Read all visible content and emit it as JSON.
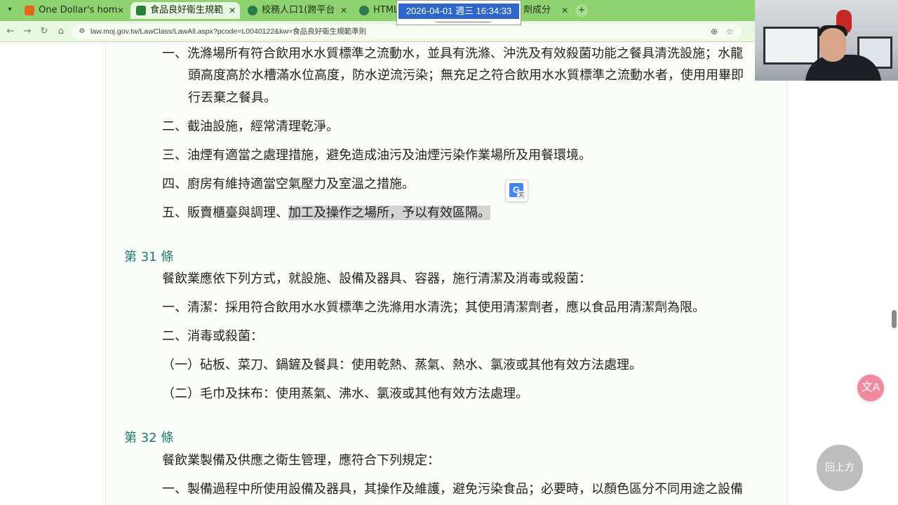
{
  "browser": {
    "tabs": [
      {
        "title": "One Dollar's hom",
        "favicon_color": "#e2651b"
      },
      {
        "title": "食品良好衛生規範",
        "favicon_color": "#2a7f3a"
      },
      {
        "title": "校務人口1(跨平台",
        "favicon_color": "#2c7b4b"
      },
      {
        "title": "HTML5",
        "favicon_color": "#2c7b4b"
      },
      {
        "title": "劑成分",
        "favicon_color": "#2c7b4b"
      }
    ],
    "new_tab": "+",
    "url": "law.moj.gov.tw/LawClass/LawAll.aspx?pcode=L0040122&kw=食品良好衛生規範準則"
  },
  "clock": {
    "datetime": "2026-04-01 週三 16:34:33"
  },
  "content": {
    "art30_items": [
      "一、洗滌場所有符合飲用水水質標準之流動水，並具有洗滌、沖洗及有效殺菌功能之餐具清洗設施；水龍",
      "頭高度高於水槽滿水位高度，防水逆流污染；無充足之符合飲用水水質標準之流動水者，使用用畢即",
      "行丟棄之餐具。",
      "二、截油設施，經常清理乾淨。",
      "三、油煙有適當之處理措施，避免造成油污及油煙污染作業場所及用餐環境。",
      "四、廚房有維持適當空氣壓力及室溫之措施。"
    ],
    "art30_item5_plain": "五、販賣櫃臺與調理、",
    "art30_item5_highlight": "加工及操作之場所，予以有效區隔。",
    "art31": {
      "title": "第 31 條",
      "lines": [
        "餐飲業應依下列方式，就設施、設備及器具、容器，施行清潔及消毒或殺菌：",
        "一、清潔：採用符合飲用水水質標準之洗滌用水清洗；其使用清潔劑者，應以食品用清潔劑為限。",
        "二、消毒或殺菌：",
        "（一）砧板、菜刀、鍋鏟及餐具：使用乾熱、蒸氣、熱水、氯液或其他有效方法處理。",
        "（二）毛巾及抹布：使用蒸氣、沸水、氯液或其他有效方法處理。"
      ]
    },
    "art32": {
      "title": "第 32 條",
      "lines": [
        "餐飲業製備及供應之衛生管理，應符合下列規定：",
        "一、製備過程中所使用設備及器具，其操作及維護，避免污染食品；必要時，以顏色區分不同用途之設備"
      ]
    }
  },
  "floating": {
    "translate_icon": "G",
    "translate_sub": "文",
    "float_translate_label": "文A",
    "back_to_top": "回上方"
  },
  "colors": {
    "tabbar": "#8ed36f",
    "toolbar": "#e8f7df",
    "article_title": "#1e7a6e",
    "highlight": "#d4d4d4",
    "back_to_top": "#bdbdbd",
    "float_translate": "#f08aa0"
  }
}
